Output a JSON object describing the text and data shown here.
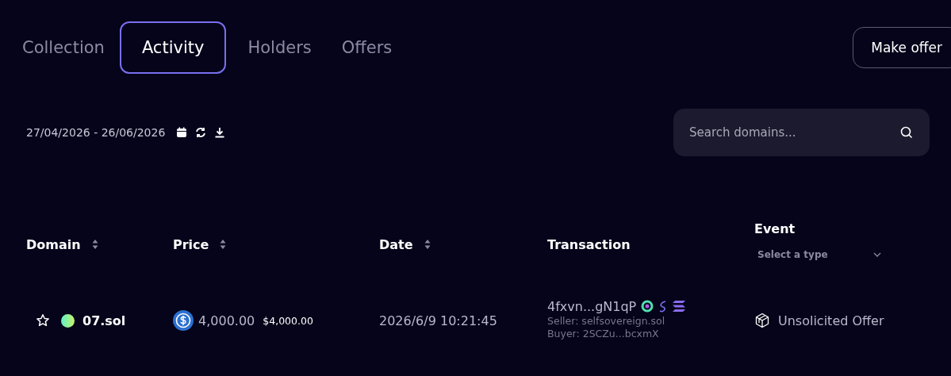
{
  "tabs": [
    {
      "label": "Collection",
      "selected": false
    },
    {
      "label": "Activity",
      "selected": true
    },
    {
      "label": "Holders",
      "selected": false
    },
    {
      "label": "Offers",
      "selected": false
    }
  ],
  "make_offer_button": "Make offer",
  "date_range": "27/04/2026 - 26/06/2026",
  "search": {
    "placeholder": "Search domains..."
  },
  "table": {
    "columns": [
      {
        "label": "Domain",
        "sortable": true
      },
      {
        "label": "Price",
        "sortable": true
      },
      {
        "label": "Date",
        "sortable": true
      },
      {
        "label": "Transaction",
        "sortable": false
      },
      {
        "label": "Event",
        "sortable": false,
        "filter_placeholder": "Select a type"
      }
    ],
    "rows": [
      {
        "domain": "07.sol",
        "price": "4,000.00",
        "price_usd": "$4,000.00",
        "date": "2026/6/9 10:21:45",
        "transaction": "4fxvn...gN1qP",
        "seller": "Seller: selfsovereign.sol",
        "buyer": "Buyer: 2SCZu...bcxmX",
        "event": "Unsolicited Offer"
      }
    ]
  }
}
